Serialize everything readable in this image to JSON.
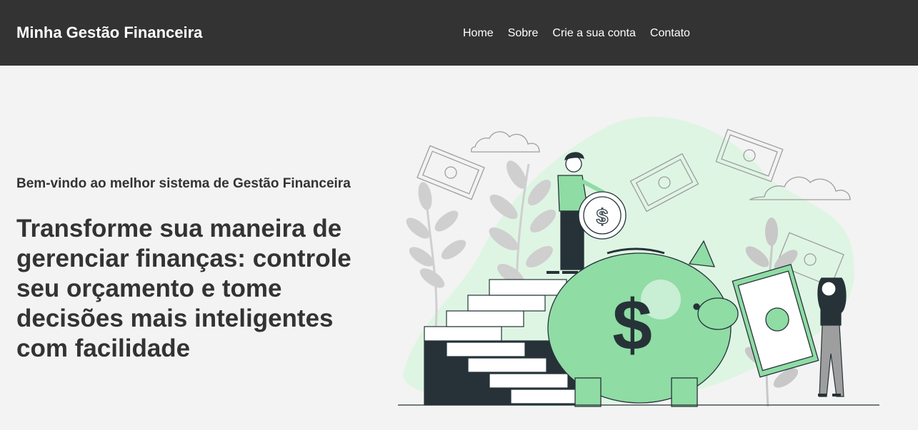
{
  "header": {
    "brand": "Minha Gestão Financeira",
    "nav": [
      {
        "label": "Home"
      },
      {
        "label": "Sobre"
      },
      {
        "label": "Crie a sua conta"
      },
      {
        "label": "Contato"
      }
    ]
  },
  "hero": {
    "subtitle": "Bem-vindo ao melhor sistema de Gestão Financeira",
    "title": "Transforme sua maneira de gerenciar finanças: controle seu orçamento e tome decisões mais inteligentes com facilidade",
    "illustration": {
      "icon": "piggy-bank-illustration",
      "symbol": "$"
    }
  },
  "colors": {
    "header_bg": "#333333",
    "page_bg": "#f3f3f3",
    "text": "#333333",
    "accent_green": "#8fdca4",
    "light_green": "#dff5e4",
    "dark": "#263238"
  }
}
